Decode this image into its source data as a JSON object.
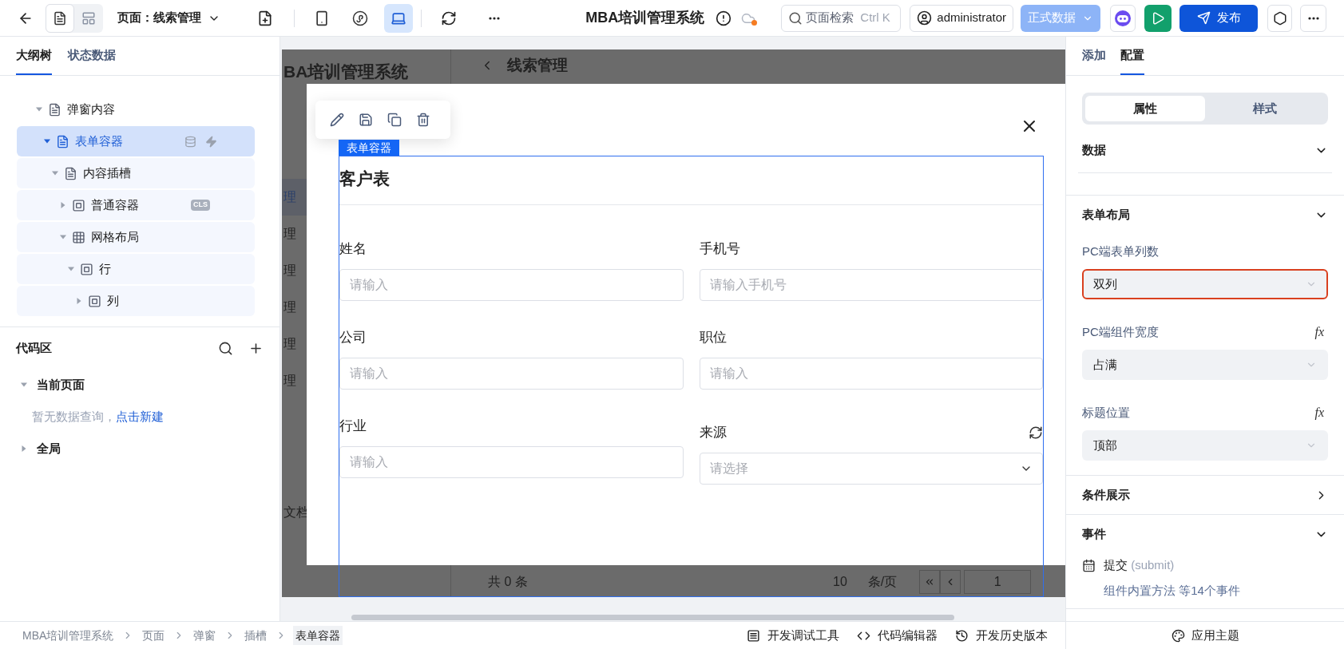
{
  "topbar": {
    "view_modes": [
      {
        "kind": "outline",
        "selected": true
      },
      {
        "kind": "layout",
        "selected": false
      }
    ],
    "page_selector": "页面：线索管理",
    "devices": [
      {
        "kind": "mobile",
        "selected": false
      },
      {
        "kind": "miniprogram",
        "selected": false
      },
      {
        "kind": "desktop",
        "selected": true
      }
    ],
    "app_title": "MBA培训管理系统",
    "search": {
      "placeholder": "页面检索",
      "shortcut": "Ctrl K"
    },
    "user": "administrator",
    "env_button": {
      "label": "正式数据",
      "disabled": true
    },
    "publish_button": "发布"
  },
  "outline_panel": {
    "tabs": [
      {
        "label": "大纲树",
        "selected": true
      },
      {
        "label": "状态数据",
        "selected": false
      }
    ],
    "tree": [
      {
        "label": "弹窗内容",
        "kind": "form",
        "expanded": true,
        "selected": false,
        "children": [
          {
            "label": "表单容器",
            "kind": "form",
            "expanded": true,
            "selected": true,
            "badges": [
              {
                "kind": "data"
              },
              {
                "kind": "event"
              }
            ],
            "children": [
              {
                "label": "内容插槽",
                "kind": "form",
                "expanded": true,
                "selected": false,
                "children": [
                  {
                    "label": "普通容器",
                    "kind": "container",
                    "expanded": false,
                    "selected": false,
                    "tag": "CLS"
                  },
                  {
                    "label": "网格布局",
                    "kind": "grid",
                    "expanded": true,
                    "selected": false,
                    "children": [
                      {
                        "label": "行",
                        "kind": "container",
                        "expanded": true,
                        "selected": false,
                        "children": [
                          {
                            "label": "列",
                            "kind": "container",
                            "expanded": false,
                            "selected": false
                          }
                        ]
                      }
                    ]
                  }
                ]
              }
            ]
          }
        ]
      }
    ]
  },
  "code_area": {
    "title": "代码区",
    "groups": [
      {
        "label": "当前页面",
        "expanded": true,
        "empty_text": "暂无数据查询，",
        "link": "点击新建"
      },
      {
        "label": "全局",
        "expanded": false
      }
    ]
  },
  "canvas": {
    "background_page": {
      "app_title": "BA培训管理系统",
      "page_title": "线索管理",
      "menu_items": [
        {
          "label": "理",
          "selected": true
        },
        {
          "label": "理",
          "selected": false
        },
        {
          "label": "理",
          "selected": false
        },
        {
          "label": "理",
          "selected": false
        },
        {
          "label": "理",
          "selected": false
        },
        {
          "label": "理",
          "selected": false
        }
      ],
      "footer_item": "文档",
      "total": "共 0 条",
      "page_size": "10",
      "page_size_unit": "条/页",
      "current_page": "1"
    },
    "selection": {
      "tag": "表单容器"
    },
    "form": {
      "title": "客户表",
      "fields": [
        {
          "label": "姓名",
          "placeholder": "请输入",
          "kind": "input",
          "refreshable": false
        },
        {
          "label": "手机号",
          "placeholder": "请输入手机号",
          "kind": "input",
          "refreshable": false
        },
        {
          "label": "公司",
          "placeholder": "请输入",
          "kind": "input",
          "refreshable": false
        },
        {
          "label": "职位",
          "placeholder": "请输入",
          "kind": "input",
          "refreshable": false
        },
        {
          "label": "行业",
          "placeholder": "请输入",
          "kind": "input",
          "refreshable": false
        },
        {
          "label": "来源",
          "placeholder": "请选择",
          "kind": "select",
          "refreshable": true
        }
      ]
    }
  },
  "config_panel": {
    "tabs": [
      {
        "label": "添加",
        "selected": false
      },
      {
        "label": "配置",
        "selected": true
      }
    ],
    "segments": [
      {
        "label": "属性",
        "selected": true
      },
      {
        "label": "样式",
        "selected": false
      }
    ],
    "sections": [
      {
        "title": "数据",
        "expanded": true,
        "kind": "empty"
      },
      {
        "title": "表单布局",
        "expanded": true,
        "kind": "settings",
        "settings": [
          {
            "label": "PC端表单列数",
            "value": "双列",
            "focused": true
          },
          {
            "label": "PC端组件宽度",
            "value": "占满",
            "focused": false,
            "formula": "fx"
          },
          {
            "label": "标题位置",
            "value": "顶部",
            "focused": false,
            "formula": "fx"
          }
        ]
      },
      {
        "title": "条件展示",
        "expanded": false
      },
      {
        "title": "事件",
        "expanded": true,
        "kind": "events",
        "events": [
          {
            "name": "提交",
            "code": "(submit)"
          }
        ],
        "summary": "组件内置方法 等14个事件"
      }
    ]
  },
  "status_bar": {
    "breadcrumb": [
      {
        "label": "MBA培训管理系统",
        "selected": false
      },
      {
        "label": "页面",
        "selected": false
      },
      {
        "label": "弹窗",
        "selected": false
      },
      {
        "label": "插槽",
        "selected": false
      },
      {
        "label": "表单容器",
        "selected": true
      }
    ],
    "tools": [
      {
        "kind": "debug",
        "label": "开发调试工具"
      },
      {
        "kind": "code",
        "label": "代码编辑器"
      },
      {
        "kind": "history",
        "label": "开发历史版本"
      }
    ],
    "theme": "应用主题"
  }
}
